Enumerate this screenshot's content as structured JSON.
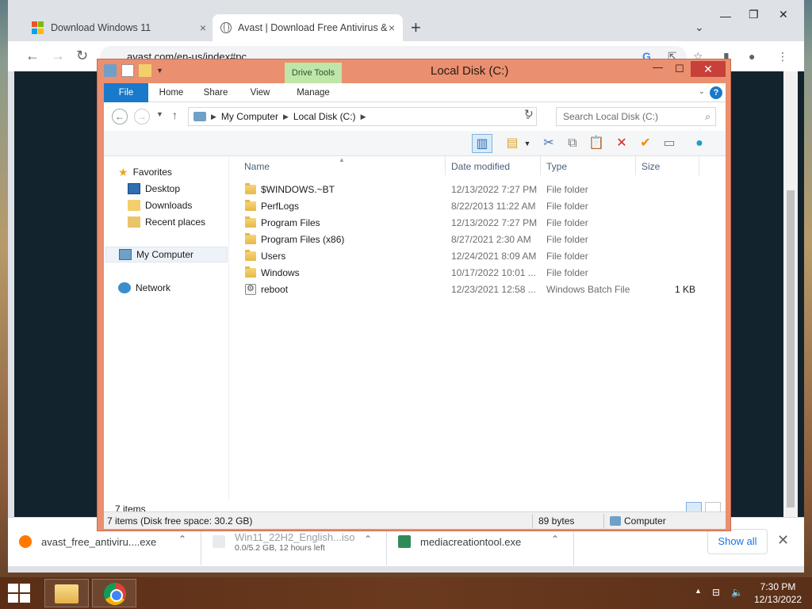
{
  "browser": {
    "tabs": [
      {
        "title": "Download Windows 11",
        "close": "×"
      },
      {
        "title": "Avast | Download Free Antivirus &",
        "close": "×"
      }
    ],
    "new_tab": "+",
    "url": "avast.com/en-us/index#pc",
    "downloads": [
      {
        "name": "avast_free_antiviru....exe",
        "sub": ""
      },
      {
        "name": "Win11_22H2_English...iso",
        "sub": "0.0/5.2 GB, 12 hours left"
      },
      {
        "name": "mediacreationtool.exe",
        "sub": ""
      }
    ],
    "show_all": "Show all"
  },
  "explorer": {
    "title": "Local Disk (C:)",
    "contextual_tab": "Drive Tools",
    "ribbon_tabs": [
      "File",
      "Home",
      "Share",
      "View",
      "Manage"
    ],
    "breadcrumb": [
      "My Computer",
      "Local Disk (C:)"
    ],
    "search_placeholder": "Search Local Disk (C:)",
    "nav": {
      "favorites": "Favorites",
      "desktop": "Desktop",
      "downloads": "Downloads",
      "recent": "Recent places",
      "computer": "My Computer",
      "network": "Network"
    },
    "columns": {
      "name": "Name",
      "date": "Date modified",
      "type": "Type",
      "size": "Size"
    },
    "files": [
      {
        "name": "$WINDOWS.~BT",
        "date": "12/13/2022 7:27 PM",
        "type": "File folder",
        "size": ""
      },
      {
        "name": "PerfLogs",
        "date": "8/22/2013 11:22 AM",
        "type": "File folder",
        "size": ""
      },
      {
        "name": "Program Files",
        "date": "12/13/2022 7:27 PM",
        "type": "File folder",
        "size": ""
      },
      {
        "name": "Program Files (x86)",
        "date": "8/27/2021 2:30 AM",
        "type": "File folder",
        "size": ""
      },
      {
        "name": "Users",
        "date": "12/24/2021 8:09 AM",
        "type": "File folder",
        "size": ""
      },
      {
        "name": "Windows",
        "date": "10/17/2022 10:01 ...",
        "type": "File folder",
        "size": ""
      },
      {
        "name": "reboot",
        "date": "12/23/2021 12:58 ...",
        "type": "Windows Batch File",
        "size": "1 KB"
      }
    ],
    "item_count": "7 items",
    "status": {
      "items": "7 items (Disk free space: 30.2 GB)",
      "bytes": "89 bytes",
      "location": "Computer"
    }
  },
  "taskbar": {
    "time": "7:30 PM",
    "date": "12/13/2022"
  }
}
